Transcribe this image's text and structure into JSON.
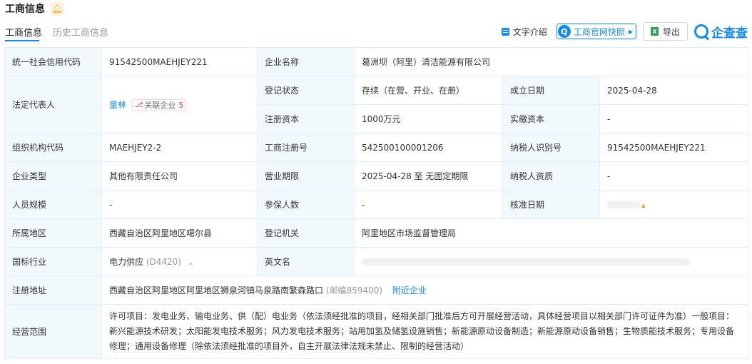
{
  "header": {
    "title": "工商信息"
  },
  "tabs": [
    {
      "label": "工商信息",
      "active": true
    },
    {
      "label": "历史工商信息",
      "active": false
    }
  ],
  "toolbar": {
    "text_intro": "文字介绍",
    "snapshot": "工商官网快照",
    "export": "导出",
    "brand": "企查查"
  },
  "labels": {
    "credit_code": "统一社会信用代码",
    "company_name": "企业名称",
    "legal_rep": "法定代表人",
    "reg_status": "登记状态",
    "founded": "成立日期",
    "reg_capital": "注册资本",
    "paid_capital": "实缴资本",
    "org_code": "组织机构代码",
    "reg_no": "工商注册号",
    "taxpayer_id": "纳税人识别号",
    "company_type": "企业类型",
    "term": "营业期限",
    "taxpayer_qual": "纳税人资质",
    "staff_size": "人员规模",
    "insured": "参保人数",
    "approval_date": "核准日期",
    "region": "所属地区",
    "authority": "登记机关",
    "industry": "国标行业",
    "english_name": "英文名",
    "address": "注册地址",
    "scope": "经营范围"
  },
  "values": {
    "credit_code": "91542500MAEHJEY221",
    "company_name": "葛洲坝（阿里）清洁能源有限公司",
    "legal_rep": "童林",
    "related_tag": "关联企业",
    "related_count": "5",
    "reg_status": "存续（在营、开业、在册）",
    "founded": "2025-04-28",
    "reg_capital": "1000万元",
    "paid_capital": "-",
    "org_code": "MAEHJEY2-2",
    "reg_no": "542500100001206",
    "taxpayer_id": "91542500MAEHJEY221",
    "company_type": "其他有限责任公司",
    "term": "2025-04-28 至 无固定期限",
    "taxpayer_qual": "-",
    "staff_size": "-",
    "insured": "-",
    "region": "西藏自治区阿里地区噶尔县",
    "authority": "阿里地区市场监督管理局",
    "industry": "电力供应",
    "industry_code": "(D4420)",
    "address": "西藏自治区阿里地区阿里地区狮泉河镇马泉路南繁森路口",
    "postcode": "(邮编859400)",
    "nearby": "附近企业",
    "scope": "许可项目：发电业务、输电业务、供（配）电业务（依法须经批准的项目，经相关部门批准后方可开展经营活动，具体经营项目以相关部门许可证件为准）一般项目：新兴能源技术研发；太阳能发电技术服务；风力发电技术服务；站用加氢及储氢设施销售；新能源原动设备制造；新能源原动设备销售；生物质能技术服务；专用设备修理；通用设备修理（除依法须经批准的项目外，自主开展法律法规未禁止、限制的经营活动）"
  },
  "colors": {
    "accent": "#128bed",
    "label_bg": "#f2f9fc",
    "border": "#e4eef6",
    "tag_red": "#f04142",
    "bell": "#f2a93b"
  },
  "icons": [
    "bell-icon",
    "text-doc-icon",
    "qcc-logo-icon",
    "chevron-right-icon",
    "excel-icon",
    "qcc-brand-icon",
    "related-company-icon",
    "lock-icon",
    "chevron-down-icon"
  ]
}
